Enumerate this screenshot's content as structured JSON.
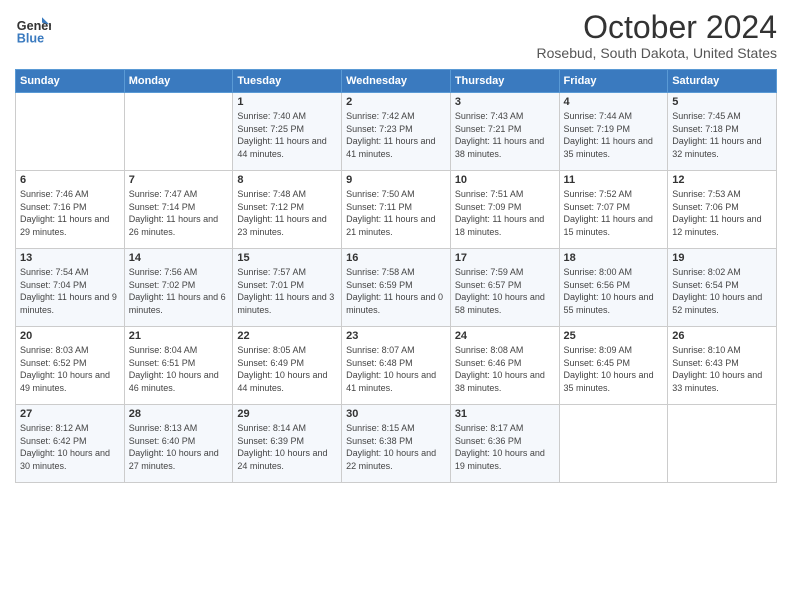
{
  "logo": {
    "line1": "General",
    "line2": "Blue"
  },
  "title": "October 2024",
  "subtitle": "Rosebud, South Dakota, United States",
  "days_of_week": [
    "Sunday",
    "Monday",
    "Tuesday",
    "Wednesday",
    "Thursday",
    "Friday",
    "Saturday"
  ],
  "weeks": [
    [
      {
        "num": "",
        "sunrise": "",
        "sunset": "",
        "daylight": ""
      },
      {
        "num": "",
        "sunrise": "",
        "sunset": "",
        "daylight": ""
      },
      {
        "num": "1",
        "sunrise": "Sunrise: 7:40 AM",
        "sunset": "Sunset: 7:25 PM",
        "daylight": "Daylight: 11 hours and 44 minutes."
      },
      {
        "num": "2",
        "sunrise": "Sunrise: 7:42 AM",
        "sunset": "Sunset: 7:23 PM",
        "daylight": "Daylight: 11 hours and 41 minutes."
      },
      {
        "num": "3",
        "sunrise": "Sunrise: 7:43 AM",
        "sunset": "Sunset: 7:21 PM",
        "daylight": "Daylight: 11 hours and 38 minutes."
      },
      {
        "num": "4",
        "sunrise": "Sunrise: 7:44 AM",
        "sunset": "Sunset: 7:19 PM",
        "daylight": "Daylight: 11 hours and 35 minutes."
      },
      {
        "num": "5",
        "sunrise": "Sunrise: 7:45 AM",
        "sunset": "Sunset: 7:18 PM",
        "daylight": "Daylight: 11 hours and 32 minutes."
      }
    ],
    [
      {
        "num": "6",
        "sunrise": "Sunrise: 7:46 AM",
        "sunset": "Sunset: 7:16 PM",
        "daylight": "Daylight: 11 hours and 29 minutes."
      },
      {
        "num": "7",
        "sunrise": "Sunrise: 7:47 AM",
        "sunset": "Sunset: 7:14 PM",
        "daylight": "Daylight: 11 hours and 26 minutes."
      },
      {
        "num": "8",
        "sunrise": "Sunrise: 7:48 AM",
        "sunset": "Sunset: 7:12 PM",
        "daylight": "Daylight: 11 hours and 23 minutes."
      },
      {
        "num": "9",
        "sunrise": "Sunrise: 7:50 AM",
        "sunset": "Sunset: 7:11 PM",
        "daylight": "Daylight: 11 hours and 21 minutes."
      },
      {
        "num": "10",
        "sunrise": "Sunrise: 7:51 AM",
        "sunset": "Sunset: 7:09 PM",
        "daylight": "Daylight: 11 hours and 18 minutes."
      },
      {
        "num": "11",
        "sunrise": "Sunrise: 7:52 AM",
        "sunset": "Sunset: 7:07 PM",
        "daylight": "Daylight: 11 hours and 15 minutes."
      },
      {
        "num": "12",
        "sunrise": "Sunrise: 7:53 AM",
        "sunset": "Sunset: 7:06 PM",
        "daylight": "Daylight: 11 hours and 12 minutes."
      }
    ],
    [
      {
        "num": "13",
        "sunrise": "Sunrise: 7:54 AM",
        "sunset": "Sunset: 7:04 PM",
        "daylight": "Daylight: 11 hours and 9 minutes."
      },
      {
        "num": "14",
        "sunrise": "Sunrise: 7:56 AM",
        "sunset": "Sunset: 7:02 PM",
        "daylight": "Daylight: 11 hours and 6 minutes."
      },
      {
        "num": "15",
        "sunrise": "Sunrise: 7:57 AM",
        "sunset": "Sunset: 7:01 PM",
        "daylight": "Daylight: 11 hours and 3 minutes."
      },
      {
        "num": "16",
        "sunrise": "Sunrise: 7:58 AM",
        "sunset": "Sunset: 6:59 PM",
        "daylight": "Daylight: 11 hours and 0 minutes."
      },
      {
        "num": "17",
        "sunrise": "Sunrise: 7:59 AM",
        "sunset": "Sunset: 6:57 PM",
        "daylight": "Daylight: 10 hours and 58 minutes."
      },
      {
        "num": "18",
        "sunrise": "Sunrise: 8:00 AM",
        "sunset": "Sunset: 6:56 PM",
        "daylight": "Daylight: 10 hours and 55 minutes."
      },
      {
        "num": "19",
        "sunrise": "Sunrise: 8:02 AM",
        "sunset": "Sunset: 6:54 PM",
        "daylight": "Daylight: 10 hours and 52 minutes."
      }
    ],
    [
      {
        "num": "20",
        "sunrise": "Sunrise: 8:03 AM",
        "sunset": "Sunset: 6:52 PM",
        "daylight": "Daylight: 10 hours and 49 minutes."
      },
      {
        "num": "21",
        "sunrise": "Sunrise: 8:04 AM",
        "sunset": "Sunset: 6:51 PM",
        "daylight": "Daylight: 10 hours and 46 minutes."
      },
      {
        "num": "22",
        "sunrise": "Sunrise: 8:05 AM",
        "sunset": "Sunset: 6:49 PM",
        "daylight": "Daylight: 10 hours and 44 minutes."
      },
      {
        "num": "23",
        "sunrise": "Sunrise: 8:07 AM",
        "sunset": "Sunset: 6:48 PM",
        "daylight": "Daylight: 10 hours and 41 minutes."
      },
      {
        "num": "24",
        "sunrise": "Sunrise: 8:08 AM",
        "sunset": "Sunset: 6:46 PM",
        "daylight": "Daylight: 10 hours and 38 minutes."
      },
      {
        "num": "25",
        "sunrise": "Sunrise: 8:09 AM",
        "sunset": "Sunset: 6:45 PM",
        "daylight": "Daylight: 10 hours and 35 minutes."
      },
      {
        "num": "26",
        "sunrise": "Sunrise: 8:10 AM",
        "sunset": "Sunset: 6:43 PM",
        "daylight": "Daylight: 10 hours and 33 minutes."
      }
    ],
    [
      {
        "num": "27",
        "sunrise": "Sunrise: 8:12 AM",
        "sunset": "Sunset: 6:42 PM",
        "daylight": "Daylight: 10 hours and 30 minutes."
      },
      {
        "num": "28",
        "sunrise": "Sunrise: 8:13 AM",
        "sunset": "Sunset: 6:40 PM",
        "daylight": "Daylight: 10 hours and 27 minutes."
      },
      {
        "num": "29",
        "sunrise": "Sunrise: 8:14 AM",
        "sunset": "Sunset: 6:39 PM",
        "daylight": "Daylight: 10 hours and 24 minutes."
      },
      {
        "num": "30",
        "sunrise": "Sunrise: 8:15 AM",
        "sunset": "Sunset: 6:38 PM",
        "daylight": "Daylight: 10 hours and 22 minutes."
      },
      {
        "num": "31",
        "sunrise": "Sunrise: 8:17 AM",
        "sunset": "Sunset: 6:36 PM",
        "daylight": "Daylight: 10 hours and 19 minutes."
      },
      {
        "num": "",
        "sunrise": "",
        "sunset": "",
        "daylight": ""
      },
      {
        "num": "",
        "sunrise": "",
        "sunset": "",
        "daylight": ""
      }
    ]
  ]
}
